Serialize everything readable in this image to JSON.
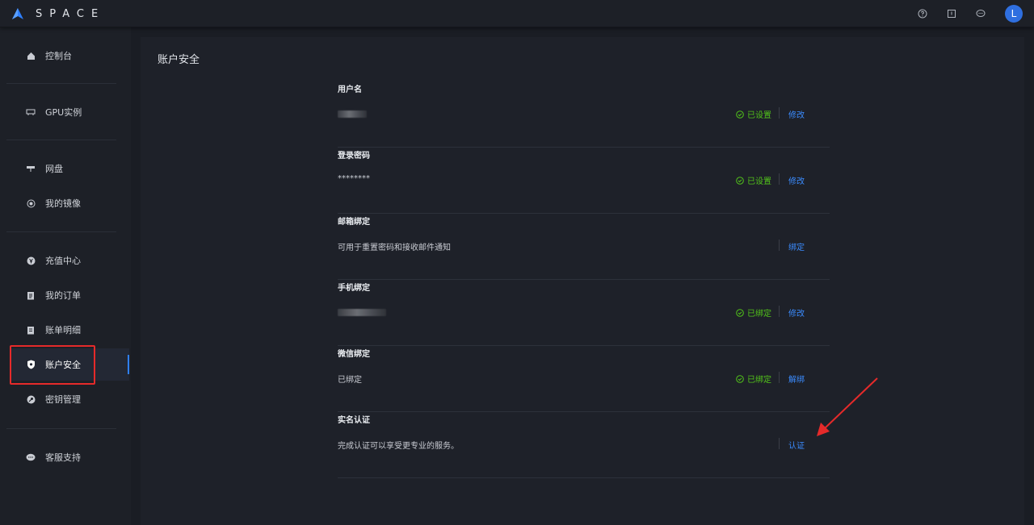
{
  "brand": {
    "logo_text": "SPACE",
    "accent": "#2f80ff"
  },
  "topbar": {
    "icons": [
      "help-icon",
      "document-icon",
      "message-icon"
    ],
    "avatar_letter": "L"
  },
  "sidebar": {
    "items": [
      {
        "label": "控制台",
        "icon": "home-icon"
      },
      {
        "label": "GPU实例",
        "icon": "gpu-icon"
      },
      {
        "label": "网盘",
        "icon": "disk-icon"
      },
      {
        "label": "我的镜像",
        "icon": "image-icon"
      },
      {
        "label": "充值中心",
        "icon": "yen-icon"
      },
      {
        "label": "我的订单",
        "icon": "order-icon"
      },
      {
        "label": "账单明细",
        "icon": "bill-icon"
      },
      {
        "label": "账户安全",
        "icon": "shield-icon",
        "active": true
      },
      {
        "label": "密钥管理",
        "icon": "key-icon"
      },
      {
        "label": "客服支持",
        "icon": "chat-icon"
      }
    ]
  },
  "main": {
    "title": "账户安全",
    "sections": [
      {
        "title": "用户名",
        "value": "",
        "status": "已设置",
        "action": "修改"
      },
      {
        "title": "登录密码",
        "value": "********",
        "status": "已设置",
        "action": "修改"
      },
      {
        "title": "邮箱绑定",
        "value": "可用于重置密码和接收邮件通知",
        "status": "",
        "action": "绑定"
      },
      {
        "title": "手机绑定",
        "value": "",
        "status": "已绑定",
        "action": "修改"
      },
      {
        "title": "微信绑定",
        "value": "已绑定",
        "status": "已绑定",
        "action": "解绑"
      },
      {
        "title": "实名认证",
        "value": "完成认证可以享受更专业的服务。",
        "status": "",
        "action": "认证"
      }
    ]
  },
  "colors": {
    "status_green": "#52c41a",
    "link_blue": "#3b8cff",
    "highlight_red": "#e62a2a"
  }
}
